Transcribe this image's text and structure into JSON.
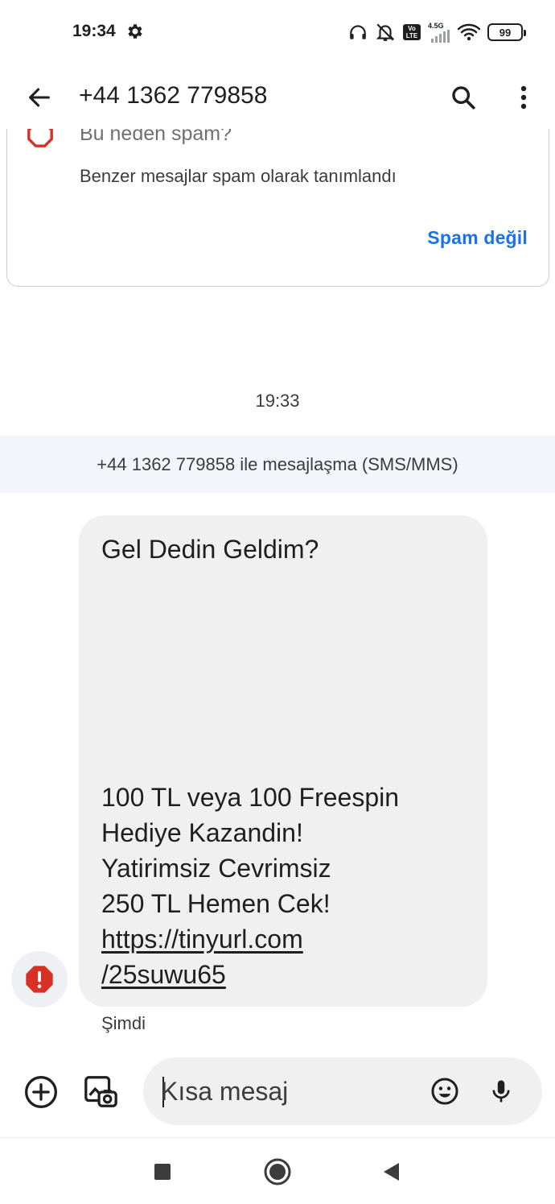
{
  "status_bar": {
    "time": "19:34",
    "network_type": "4.5G",
    "volte_label": "Vo LTE",
    "battery": "99"
  },
  "app_bar": {
    "title": "+44 1362 779858"
  },
  "spam_card": {
    "question": "Bu neden spam?",
    "description": "Benzer mesajlar spam olarak tanımlandı",
    "not_spam_label": "Spam değil"
  },
  "conversation": {
    "timestamp": "19:33",
    "banner": "+44 1362 779858 ile mesajlaşma (SMS/MMS)"
  },
  "message": {
    "title": "Gel Dedin Geldim?",
    "lines": [
      "100 TL veya 100 Freespin",
      "Hediye Kazandin!",
      "Yatirimsiz Cevrimsiz",
      "250 TL Hemen Cek!"
    ],
    "link_line_1": "https://tinyurl.com",
    "link_line_2": "/25suwu65",
    "time": "Şimdi",
    "status_icon": "error-icon"
  },
  "compose": {
    "placeholder": "Kısa mesaj"
  },
  "icons": {
    "status": [
      "settings-gear-icon",
      "headphones-icon",
      "notifications-off-icon",
      "volte-icon",
      "signal-icon",
      "wifi-icon",
      "battery-icon"
    ],
    "app_bar": [
      "back-arrow-icon",
      "search-icon",
      "more-vert-icon"
    ],
    "compose": [
      "add-circle-icon",
      "gallery-icon",
      "emoji-icon",
      "mic-icon"
    ],
    "nav": [
      "recents-square-icon",
      "home-circle-icon",
      "back-triangle-icon"
    ]
  },
  "colors": {
    "accent": "#1a73e8",
    "error": "#d93025",
    "bubble": "#f0f0f0",
    "banner": "#f2f5fa"
  }
}
